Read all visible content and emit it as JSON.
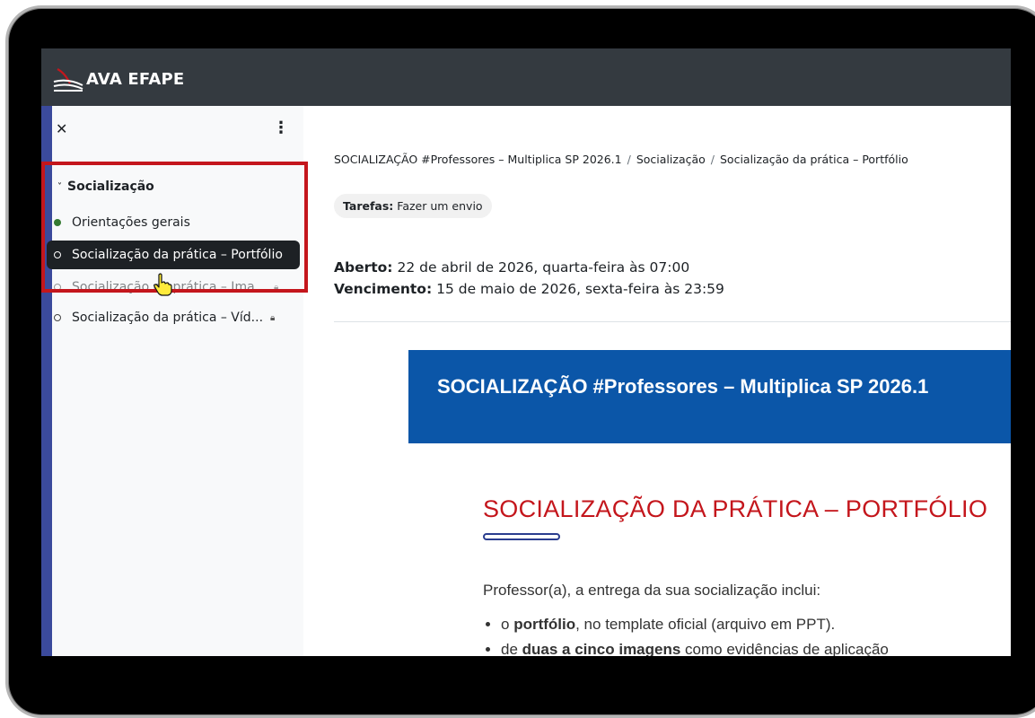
{
  "brand": {
    "name": "AVA EFAPE"
  },
  "sidebar": {
    "close_icon": "close-icon",
    "more_icon": "kebab-icon",
    "section": {
      "label": "Socialização"
    },
    "items": [
      {
        "label": "Orientações gerais",
        "status": "complete"
      },
      {
        "label": "Socialização da prática – Portfólio",
        "status": "active"
      },
      {
        "label": "Socialização da prática – Ima...",
        "status": "locked"
      },
      {
        "label": "Socialização da prática – Víd...",
        "status": "locked"
      }
    ]
  },
  "breadcrumb": {
    "items": [
      "SOCIALIZAÇÃO #Professores – Multiplica SP 2026.1",
      "Socialização",
      "Socialização da prática – Portfólio"
    ],
    "separator": "/"
  },
  "activity": {
    "type_label": "Tarefas:",
    "type_value": "Fazer um envio",
    "opened_label": "Aberto:",
    "opened_value": "22 de abril de 2026, quarta-feira às 07:00",
    "due_label": "Vencimento:",
    "due_value": "15 de maio de 2026, sexta-feira às 23:59"
  },
  "content": {
    "banner_title": "SOCIALIZAÇÃO #Professores – Multiplica SP 2026.1",
    "heading": "SOCIALIZAÇÃO DA PRÁTICA – PORTFÓLIO",
    "intro": "Professor(a), a entrega da sua socialização inclui:",
    "bullet1_pre": "o ",
    "bullet1_bold": "portfólio",
    "bullet1_post": ", no template oficial (arquivo em PPT).",
    "bullet2_pre": "de ",
    "bullet2_bold": "duas a cinco imagens",
    "bullet2_post": " como evidências de aplicação"
  },
  "colors": {
    "topbar": "#343a40",
    "accent_red": "#c4161c",
    "banner_blue": "#0b56a8",
    "sidebar_edge": "#3b4a9c"
  }
}
